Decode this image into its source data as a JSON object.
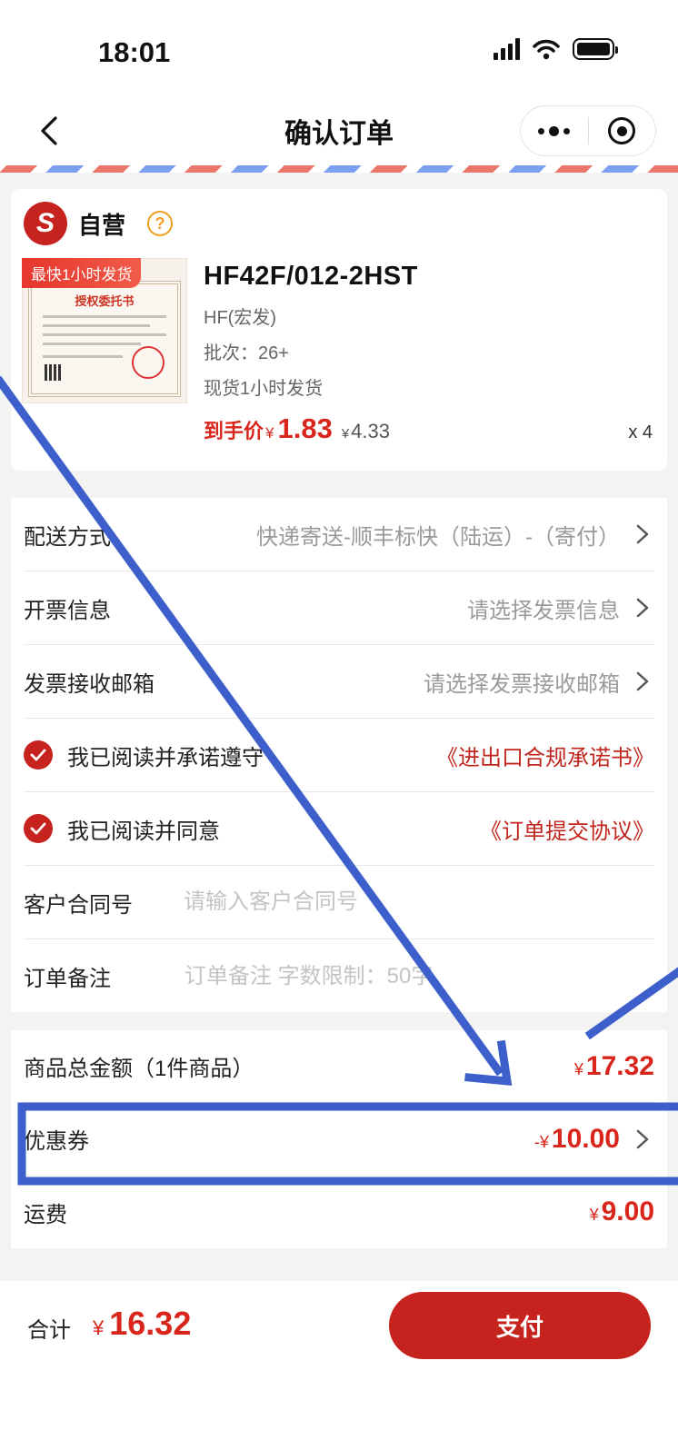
{
  "status_bar": {
    "time": "18:01"
  },
  "nav": {
    "title": "确认订单"
  },
  "shop": {
    "name": "自营",
    "logo_letter": "S"
  },
  "product": {
    "tag": "最快1小时发货",
    "thumb_title": "授权委托书",
    "name": "HF42F/012-2HST",
    "brand": "HF(宏发)",
    "batch": "批次：26+",
    "shipping": "现货1小时发货",
    "price_label": "到手价",
    "price_currency": "¥",
    "price": "1.83",
    "original_price_currency": "¥",
    "original_price": "4.33",
    "quantity": "x 4"
  },
  "options": {
    "delivery": {
      "label": "配送方式",
      "value": "快递寄送-顺丰标快（陆运）-（寄付）"
    },
    "invoice": {
      "label": "开票信息",
      "value": "请选择发票信息"
    },
    "invoice_email": {
      "label": "发票接收邮箱",
      "value": "请选择发票接收邮箱"
    },
    "compliance": {
      "label": "我已阅读并承诺遵守",
      "link": "《进出口合规承诺书》",
      "checked": true
    },
    "agreement": {
      "label": "我已阅读并同意",
      "link": "《订单提交协议》",
      "checked": true
    },
    "contract": {
      "label": "客户合同号",
      "placeholder": "请输入客户合同号"
    },
    "remark": {
      "label": "订单备注",
      "placeholder": "订单备注 字数限制：50字"
    }
  },
  "amounts": {
    "subtotal": {
      "label": "商品总金额（1件商品）",
      "currency": "¥",
      "value": "17.32"
    },
    "coupon": {
      "label": "优惠券",
      "currency": "-¥",
      "value": "10.00"
    },
    "freight": {
      "label": "运费",
      "currency": "¥",
      "value": "9.00"
    }
  },
  "footer": {
    "total_label": "合计",
    "currency": "¥",
    "total": "16.32",
    "pay_label": "支付"
  },
  "colors": {
    "accent": "#c6231e",
    "price_red": "#d9261c",
    "annotation_blue": "#3d5fcb"
  }
}
